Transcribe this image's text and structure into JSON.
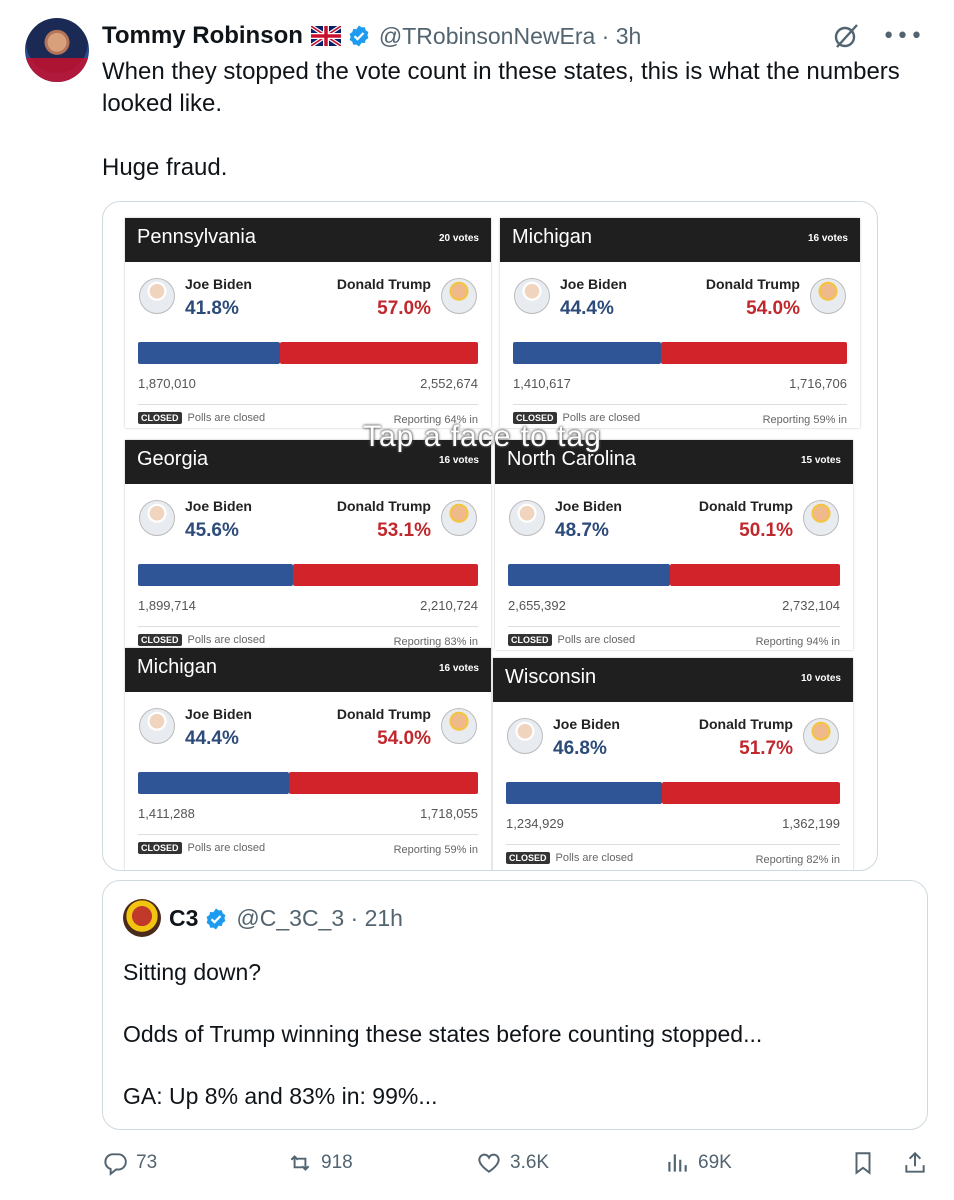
{
  "tweet": {
    "author_name": "Tommy Robinson",
    "author_handle": "@TRobinsonNewEra",
    "time": "3h",
    "text": "When they stopped the vote count in these states, this is what the numbers looked like.\n\nHuge fraud."
  },
  "media": {
    "overlay_text": "Tap a face to tag",
    "panels": [
      {
        "state": "Pennsylvania",
        "votes": "20 votes",
        "biden_label": "Joe Biden",
        "biden_pct": "41.8%",
        "trump_label": "Donald Trump",
        "trump_pct": "57.0%",
        "biden_count": "1,870,010",
        "trump_count": "2,552,674",
        "closed": "CLOSED",
        "status": "Polls are closed",
        "reporting": "Reporting 64% in",
        "biden_share": 0.418
      },
      {
        "state": "Michigan",
        "votes": "16 votes",
        "biden_label": "Joe Biden",
        "biden_pct": "44.4%",
        "trump_label": "Donald Trump",
        "trump_pct": "54.0%",
        "biden_count": "1,410,617",
        "trump_count": "1,716,706",
        "closed": "CLOSED",
        "status": "Polls are closed",
        "reporting": "Reporting 59% in",
        "biden_share": 0.444
      },
      {
        "state": "Georgia",
        "votes": "16 votes",
        "biden_label": "Joe Biden",
        "biden_pct": "45.6%",
        "trump_label": "Donald Trump",
        "trump_pct": "53.1%",
        "biden_count": "1,899,714",
        "trump_count": "2,210,724",
        "closed": "CLOSED",
        "status": "Polls are closed",
        "reporting": "Reporting 83% in",
        "biden_share": 0.456
      },
      {
        "state": "North Carolina",
        "votes": "15 votes",
        "biden_label": "Joe Biden",
        "biden_pct": "48.7%",
        "trump_label": "Donald Trump",
        "trump_pct": "50.1%",
        "biden_count": "2,655,392",
        "trump_count": "2,732,104",
        "closed": "CLOSED",
        "status": "Polls are closed",
        "reporting": "Reporting 94% in",
        "biden_share": 0.487
      },
      {
        "state": "Michigan",
        "votes": "16 votes",
        "biden_label": "Joe Biden",
        "biden_pct": "44.4%",
        "trump_label": "Donald Trump",
        "trump_pct": "54.0%",
        "biden_count": "1,411,288",
        "trump_count": "1,718,055",
        "closed": "CLOSED",
        "status": "Polls are closed",
        "reporting": "Reporting 59% in",
        "biden_share": 0.444
      },
      {
        "state": "Wisconsin",
        "votes": "10 votes",
        "biden_label": "Joe Biden",
        "biden_pct": "46.8%",
        "trump_label": "Donald Trump",
        "trump_pct": "51.7%",
        "biden_count": "1,234,929",
        "trump_count": "1,362,199",
        "closed": "CLOSED",
        "status": "Polls are closed",
        "reporting": "Reporting 82% in",
        "biden_share": 0.468
      }
    ]
  },
  "quote": {
    "author_name": "C3",
    "author_handle": "@C_3C_3",
    "time": "21h",
    "text": "Sitting down?\n\nOdds of Trump winning these states before counting stopped...\n\nGA: Up 8% and 83% in: 99%..."
  },
  "actions": {
    "replies": "73",
    "reposts": "918",
    "likes": "3.6K",
    "views": "69K"
  },
  "colors": {
    "biden_blue": "#2f5596",
    "trump_red": "#d2232a",
    "verified_blue": "#1d9bf0"
  }
}
